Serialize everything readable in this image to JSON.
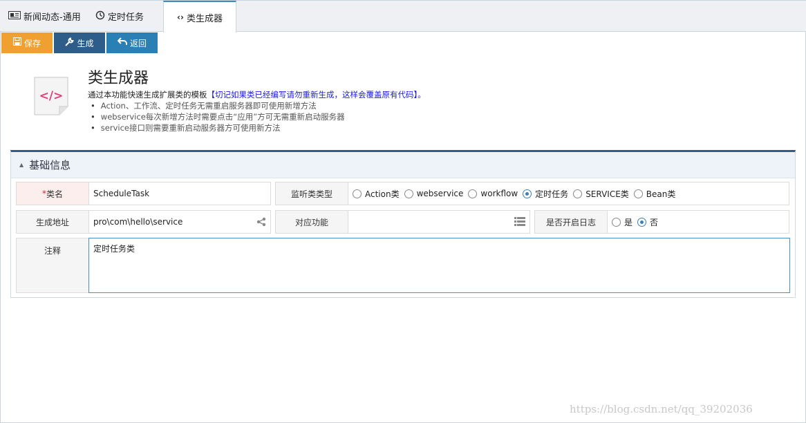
{
  "tabs": [
    {
      "label": "新闻动态-通用",
      "icon": "newspaper-icon"
    },
    {
      "label": "定时任务",
      "icon": "history-icon"
    },
    {
      "label": "类生成器",
      "icon": "code-icon",
      "active": true
    }
  ],
  "toolbar": {
    "save_label": "保存",
    "generate_label": "生成",
    "back_label": "返回",
    "colors": {
      "save": "#f0a030",
      "generate": "#2f5d8a",
      "back": "#2a7fb5"
    }
  },
  "header": {
    "title": "类生成器",
    "description": "通过本功能快速生成扩展类的模板",
    "warning": "【切记如果类已经编写请勿重新生成，这样会覆盖原有代码】。",
    "tips": [
      "Action、工作流、定时任务无需重启服务器即可使用新增方法",
      "webservice每次新增方法时需要点击“应用”方可无需重新启动服务器",
      "service接口则需要重新启动服务器方可使用新方法"
    ]
  },
  "section": {
    "title": "基础信息"
  },
  "form": {
    "class_name": {
      "required_mark": "*",
      "label": "类名",
      "value": "ScheduleTask"
    },
    "listener_type": {
      "label": "监听类类型",
      "options": [
        "Action类",
        "webservice",
        "workflow",
        "定时任务",
        "SERVICE类",
        "Bean类"
      ],
      "selected": "定时任务"
    },
    "gen_path": {
      "label": "生成地址",
      "value": "pro\\com\\hello\\service"
    },
    "function": {
      "label": "对应功能",
      "value": ""
    },
    "log": {
      "label": "是否开启日志",
      "options": [
        "是",
        "否"
      ],
      "selected": "否"
    },
    "comment": {
      "label": "注释",
      "value": "定时任务类"
    }
  },
  "watermark": "https://blog.csdn.net/qq_39202036"
}
